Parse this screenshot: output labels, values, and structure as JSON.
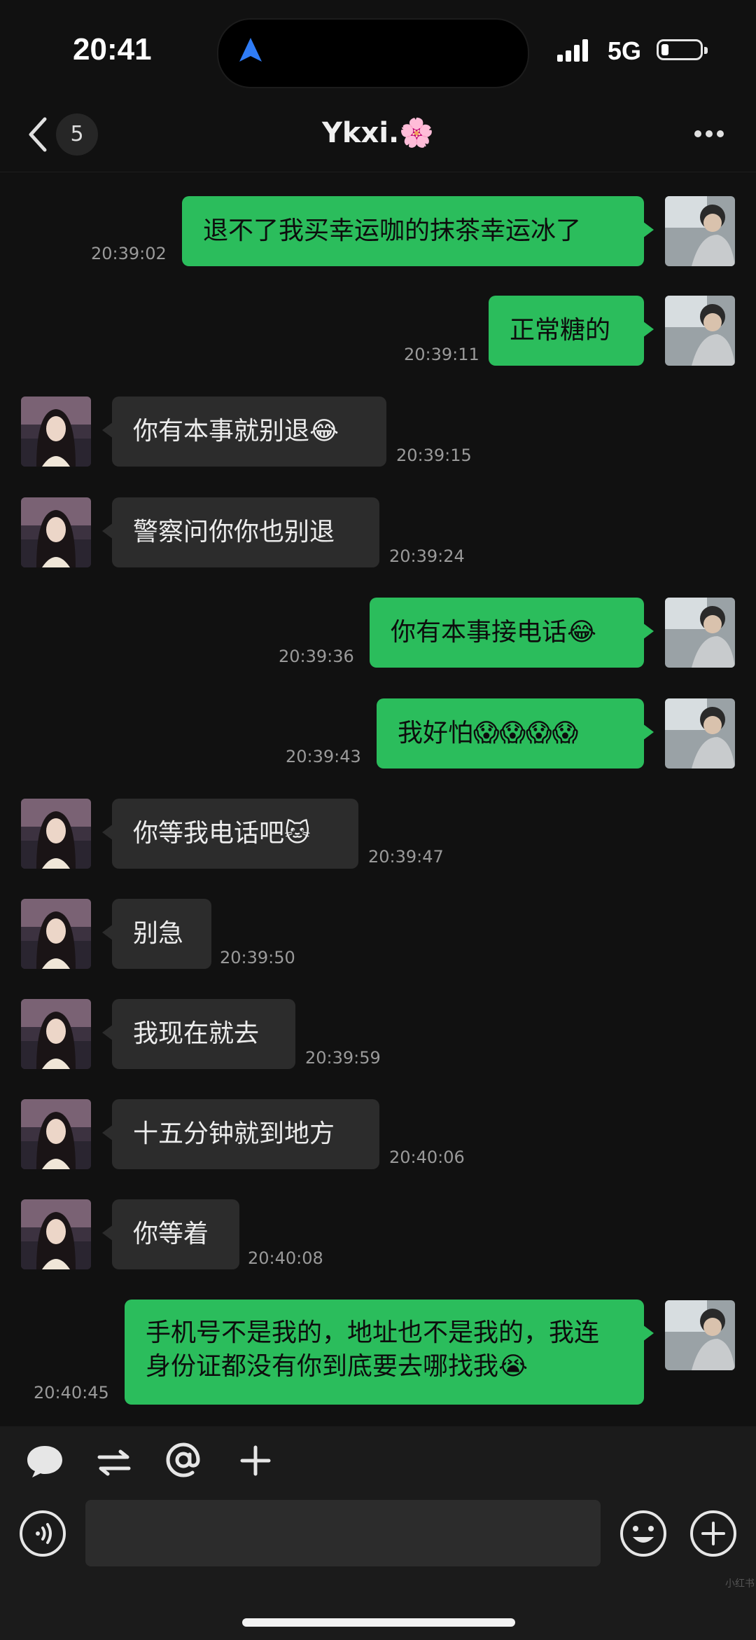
{
  "status_bar": {
    "time": "20:41",
    "network": "5G"
  },
  "header": {
    "back_count": "5",
    "title": "Ykxi.🌸"
  },
  "messages": [
    {
      "side": "out",
      "text": "退不了我买幸运咖的抹茶幸运冰了",
      "time": "20:39:02"
    },
    {
      "side": "out",
      "text": "正常糖的",
      "time": "20:39:11"
    },
    {
      "side": "in",
      "text": "你有本事就别退😂",
      "time": "20:39:15"
    },
    {
      "side": "in",
      "text": "警察问你你也别退",
      "time": "20:39:24"
    },
    {
      "side": "out",
      "text": "你有本事接电话😂",
      "time": "20:39:36"
    },
    {
      "side": "out",
      "text": "我好怕😱😱😱😱",
      "time": "20:39:43"
    },
    {
      "side": "in",
      "text": "你等我电话吧🐱",
      "time": "20:39:47"
    },
    {
      "side": "in",
      "text": "别急",
      "time": "20:39:50"
    },
    {
      "side": "in",
      "text": "我现在就去",
      "time": "20:39:59"
    },
    {
      "side": "in",
      "text": "十五分钟就到地方",
      "time": "20:40:06"
    },
    {
      "side": "in",
      "text": "你等着",
      "time": "20:40:08"
    },
    {
      "side": "out",
      "text": "手机号不是我的，地址也不是我的，我连身份证都没有你到底要去哪找我😭",
      "time": "20:40:45"
    }
  ],
  "toolbar": {
    "tools": [
      "chat-bubble-icon",
      "switch-icon",
      "mention-icon",
      "add-icon"
    ],
    "input_value": ""
  },
  "watermark": "小红书",
  "colors": {
    "background": "#111111",
    "outgoing_bubble": "#2bbd5c",
    "incoming_bubble": "#2c2c2c",
    "timestamp": "#9a9a9a"
  }
}
